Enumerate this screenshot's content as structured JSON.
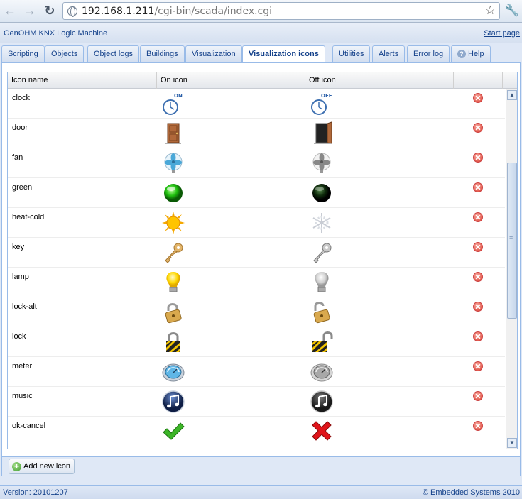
{
  "browser": {
    "url_host": "192.168.1.211",
    "url_path": "/cgi-bin/scada/index.cgi"
  },
  "header": {
    "title": "GenOHM KNX Logic Machine",
    "start_page": "Start page"
  },
  "tabs": [
    {
      "label": "Scripting"
    },
    {
      "label": "Objects"
    },
    {
      "label": "Object logs"
    },
    {
      "label": "Buildings"
    },
    {
      "label": "Visualization"
    },
    {
      "label": "Visualization icons"
    },
    {
      "label": "Utilities"
    },
    {
      "label": "Alerts"
    },
    {
      "label": "Error log"
    },
    {
      "label": "Help"
    }
  ],
  "grid": {
    "columns": [
      "Icon name",
      "On icon",
      "Off icon"
    ],
    "rows": [
      {
        "name": "clock",
        "on_text": "ON",
        "off_text": "OFF"
      },
      {
        "name": "door"
      },
      {
        "name": "fan"
      },
      {
        "name": "green"
      },
      {
        "name": "heat-cold"
      },
      {
        "name": "key"
      },
      {
        "name": "lamp"
      },
      {
        "name": "lock-alt"
      },
      {
        "name": "lock"
      },
      {
        "name": "meter"
      },
      {
        "name": "music"
      },
      {
        "name": "ok-cancel"
      }
    ]
  },
  "toolbar": {
    "add_label": "Add new icon"
  },
  "footer": {
    "version": "Version: 20101207",
    "copyright": "© Embedded Systems 2010"
  },
  "colors": {
    "accent": "#15428b",
    "panel_border": "#99bbe8",
    "background": "#dfe8f6"
  }
}
